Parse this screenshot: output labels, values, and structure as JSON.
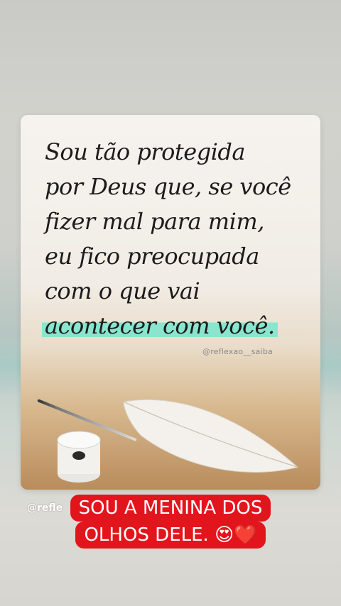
{
  "post": {
    "quote_lines": [
      "Sou tão protegida",
      "por Deus que, se você",
      "fizer mal para mim,",
      "eu fico preocupada",
      "com o que vai",
      "acontecer com você."
    ],
    "highlight_color": "#78e6cd",
    "image_watermark": "@reflexao__saiba"
  },
  "overlay": {
    "handle_partial": "@refle",
    "caption_lines": [
      "SOU A MENINA DOS",
      "OLHOS DELE. 😍❤️"
    ],
    "caption_bg_color": "#e3151c"
  }
}
